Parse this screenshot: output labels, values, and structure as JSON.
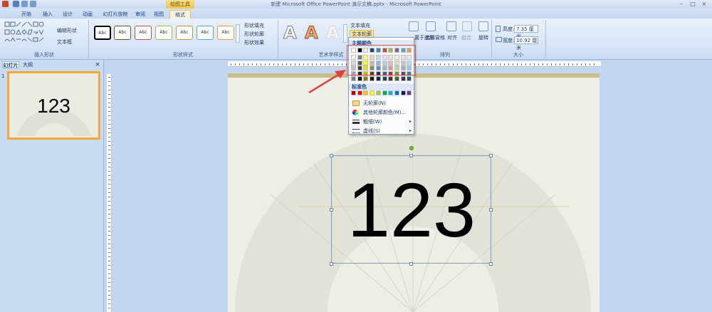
{
  "window": {
    "title": "新建 Microsoft Office PowerPoint 演示文稿.pptx - Microsoft PowerPoint",
    "context_tab_group": "绘图工具"
  },
  "tabs": [
    "开始",
    "插入",
    "设计",
    "动画",
    "幻灯片放映",
    "审阅",
    "视图",
    "格式"
  ],
  "ribbon": {
    "insert_shapes": {
      "edit_shape": "编辑形状",
      "text_box": "文本框",
      "label": "插入形状"
    },
    "shape_styles": {
      "style_sample": "Abc",
      "fill": "形状填充",
      "outline": "形状轮廓",
      "effects": "形状效果",
      "label": "形状样式"
    },
    "wordart": {
      "sample": "A",
      "text_fill": "文本填充",
      "text_outline": "文本轮廓",
      "label": "艺术字样式"
    },
    "arrange": {
      "bring_front": "置于顶层",
      "send_back": "置于底层",
      "selection_pane": "选择窗格",
      "align": "对齐",
      "group": "组合",
      "rotate": "旋转",
      "label": "排列"
    },
    "size": {
      "height_label": "高度:",
      "height_value": "7.35 厘米",
      "width_label": "宽度:",
      "width_value": "10.92 厘米",
      "label": "大小"
    }
  },
  "left_pane": {
    "tab_slides": "幻灯片",
    "tab_outline": "大纲",
    "close": "×",
    "slide_number": "1",
    "thumb_text": "123"
  },
  "slide": {
    "text": "123"
  },
  "dropdown": {
    "theme_colors_header": "主题颜色",
    "standard_colors_header": "标准色",
    "no_outline": "无轮廓(N)",
    "more_colors": "其他轮廓颜色(M)...",
    "weight": "粗细(W)",
    "dashes": "虚线(S)",
    "submenu_arrow": "▸",
    "theme_top_row": [
      "#ffffff",
      "#000000",
      "#eeece1",
      "#1f497d",
      "#4f81bd",
      "#c0504d",
      "#9bbb59",
      "#8064a2",
      "#4bacc6",
      "#f79646"
    ],
    "theme_columns": [
      [
        "#f2f2f2",
        "#d8d8d8",
        "#bfbfbf",
        "#a5a5a5",
        "#7f7f7f"
      ],
      [
        "#7f7f7f",
        "#595959",
        "#3f3f3f",
        "#262626",
        "#0c0c0c"
      ],
      [
        "#ffff66",
        "#ffff00",
        "#e5e500",
        "#bfbf00",
        "#7f7f00"
      ],
      [
        "#ddd9c3",
        "#c4bd97",
        "#938953",
        "#494429",
        "#1d1b10"
      ],
      [
        "#c6d9f0",
        "#8db3e2",
        "#548dd4",
        "#17365d",
        "#0f243e"
      ],
      [
        "#dbe5f1",
        "#b8cce4",
        "#95b3d7",
        "#366092",
        "#244061"
      ],
      [
        "#f2dcdb",
        "#e5b9b7",
        "#d99694",
        "#953734",
        "#632423"
      ],
      [
        "#ebf1dd",
        "#d7e3bc",
        "#c3d69b",
        "#76923c",
        "#4f6128"
      ],
      [
        "#e5e0ec",
        "#ccc1d9",
        "#b2a2c7",
        "#5f497a",
        "#3f3151"
      ],
      [
        "#dbeef3",
        "#b7dde8",
        "#92cddc",
        "#31859b",
        "#205867"
      ]
    ],
    "standard_colors": [
      "#c00000",
      "#ff0000",
      "#ffc000",
      "#ffff00",
      "#92d050",
      "#00b050",
      "#00b0f0",
      "#0070c0",
      "#002060",
      "#7030a0"
    ]
  }
}
